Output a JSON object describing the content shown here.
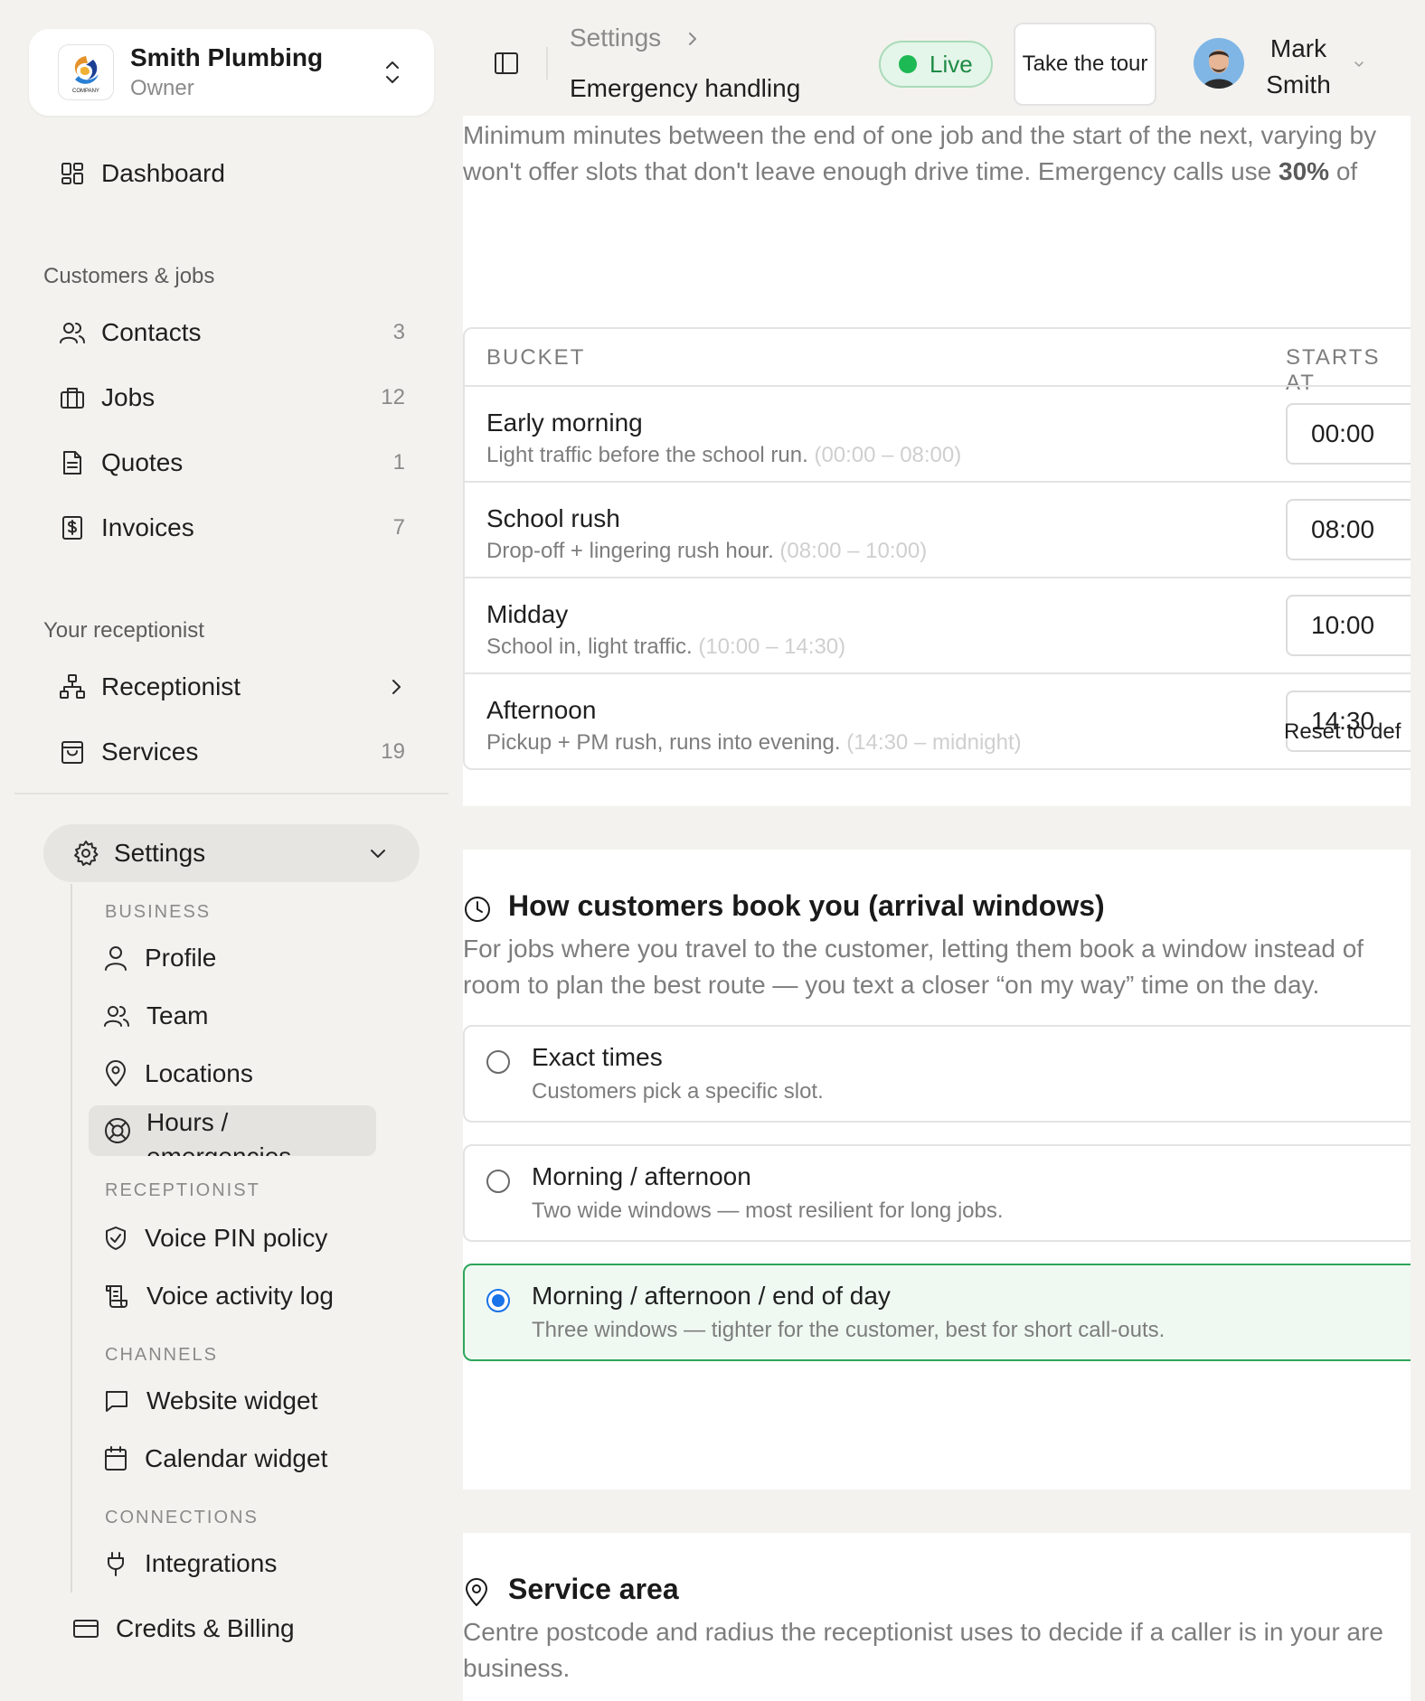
{
  "org": {
    "name": "Smith Plumbing",
    "role": "Owner",
    "logo_text": "COMPANY"
  },
  "nav": {
    "dashboard": "Dashboard",
    "group_customers": "Customers & jobs",
    "contacts": {
      "label": "Contacts",
      "count": "3"
    },
    "jobs": {
      "label": "Jobs",
      "count": "12"
    },
    "quotes": {
      "label": "Quotes",
      "count": "1"
    },
    "invoices": {
      "label": "Invoices",
      "count": "7"
    },
    "group_receptionist": "Your receptionist",
    "receptionist": "Receptionist",
    "services": {
      "label": "Services",
      "count": "19"
    },
    "settings": "Settings"
  },
  "settings_nav": {
    "business": "BUSINESS",
    "profile": "Profile",
    "team": "Team",
    "locations": "Locations",
    "hours": "Hours / emergencies",
    "receptionist": "RECEPTIONIST",
    "voice_pin": "Voice PIN policy",
    "voice_log": "Voice activity log",
    "channels": "CHANNELS",
    "website_widget": "Website widget",
    "calendar_widget": "Calendar widget",
    "connections": "CONNECTIONS",
    "integrations": "Integrations",
    "billing": "Credits & Billing"
  },
  "header": {
    "breadcrumb_parent": "Settings",
    "breadcrumb_current": "Emergency handling",
    "live": "Live",
    "tour": "Take the tour",
    "user_name": "Mark Smith"
  },
  "travel": {
    "desc_line1": "Minimum minutes between the end of one job and the start of the next, varying by",
    "desc_line2_pre": "won't offer slots that don't leave enough drive time. Emergency calls use ",
    "desc_pct": "30%",
    "desc_line2_post": " of",
    "col_bucket": "BUCKET",
    "col_starts": "STARTS AT",
    "buckets": [
      {
        "name": "Early morning",
        "desc": "Light traffic before the school run.",
        "range": "(00:00 – 08:00)",
        "start": "00:00"
      },
      {
        "name": "School rush",
        "desc": "Drop-off + lingering rush hour.",
        "range": "(08:00 – 10:00)",
        "start": "08:00"
      },
      {
        "name": "Midday",
        "desc": "School in, light traffic.",
        "range": "(10:00 – 14:30)",
        "start": "10:00"
      },
      {
        "name": "Afternoon",
        "desc": "Pickup + PM rush, runs into evening.",
        "range": "(14:30 – midnight)",
        "start": "14:30"
      }
    ],
    "reset": "Reset to def"
  },
  "arrival": {
    "title": "How customers book you (arrival windows)",
    "desc_line1": "For jobs where you travel to the customer, letting them book a window instead of",
    "desc_line2": "room to plan the best route — you text a closer “on my way” time on the day.",
    "options": [
      {
        "title": "Exact times",
        "desc": "Customers pick a specific slot."
      },
      {
        "title": "Morning / afternoon",
        "desc": "Two wide windows — most resilient for long jobs."
      },
      {
        "title": "Morning / afternoon / end of day",
        "desc": "Three windows — tighter for the customer, best for short call-outs."
      }
    ],
    "selected_index": 2
  },
  "service_area": {
    "title": "Service area",
    "desc_line1": "Centre postcode and radius the receptionist uses to decide if a caller is in your are",
    "desc_line2": "business."
  }
}
